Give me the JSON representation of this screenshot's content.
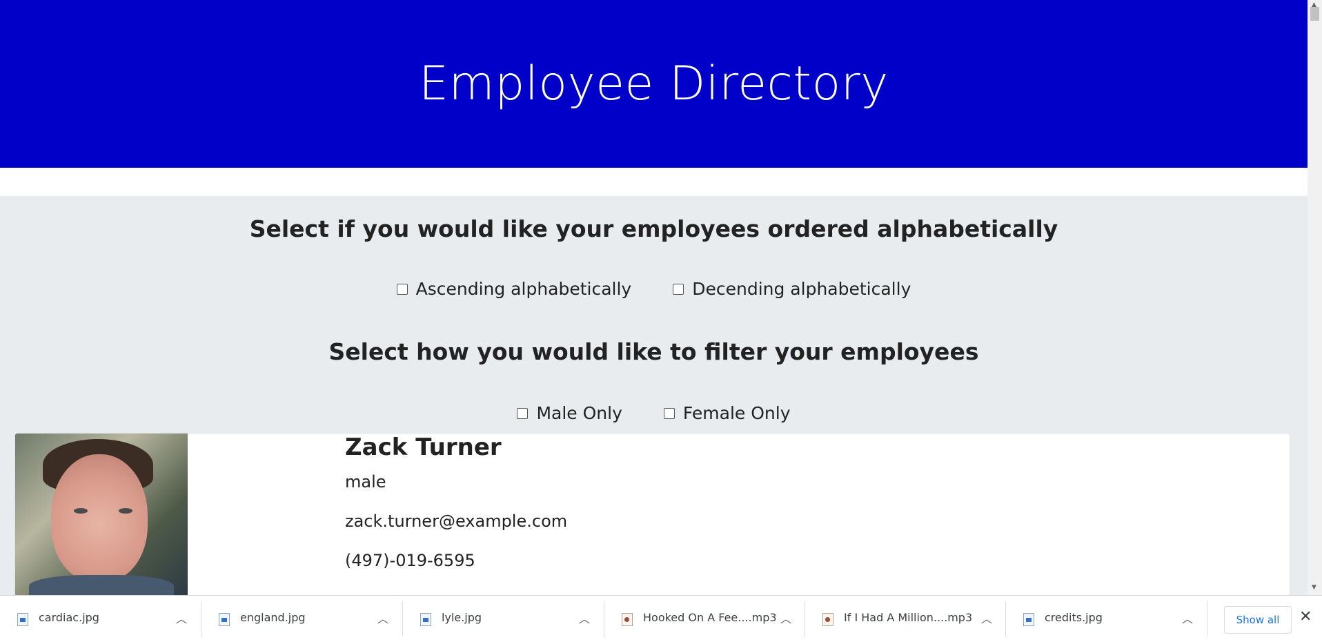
{
  "header": {
    "title": "Employee Directory"
  },
  "sort": {
    "heading": "Select if you would like your employees ordered alphabetically",
    "options": [
      {
        "label": "Ascending alphabetically",
        "checked": false
      },
      {
        "label": "Decending alphabetically",
        "checked": false
      }
    ]
  },
  "filter": {
    "heading": "Select how you would like to filter your employees",
    "options": [
      {
        "label": "Male Only",
        "checked": false
      },
      {
        "label": "Female Only",
        "checked": false
      }
    ]
  },
  "employee": {
    "name": "Zack Turner",
    "gender": "male",
    "email": "zack.turner@example.com",
    "phone": "(497)-019-6595"
  },
  "downloads": {
    "items": [
      {
        "name": "cardiac.jpg",
        "icon": "image-file-icon"
      },
      {
        "name": "england.jpg",
        "icon": "image-file-icon"
      },
      {
        "name": "lyle.jpg",
        "icon": "image-file-icon"
      },
      {
        "name": "Hooked On A Fee....mp3",
        "icon": "audio-file-icon"
      },
      {
        "name": "If I Had A Million....mp3",
        "icon": "audio-file-icon"
      },
      {
        "name": "credits.jpg",
        "icon": "image-file-icon"
      }
    ],
    "show_all": "Show all"
  },
  "colors": {
    "header_bg": "#0000c8",
    "section_bg": "#e9ecef",
    "link": "#1a73e8"
  }
}
